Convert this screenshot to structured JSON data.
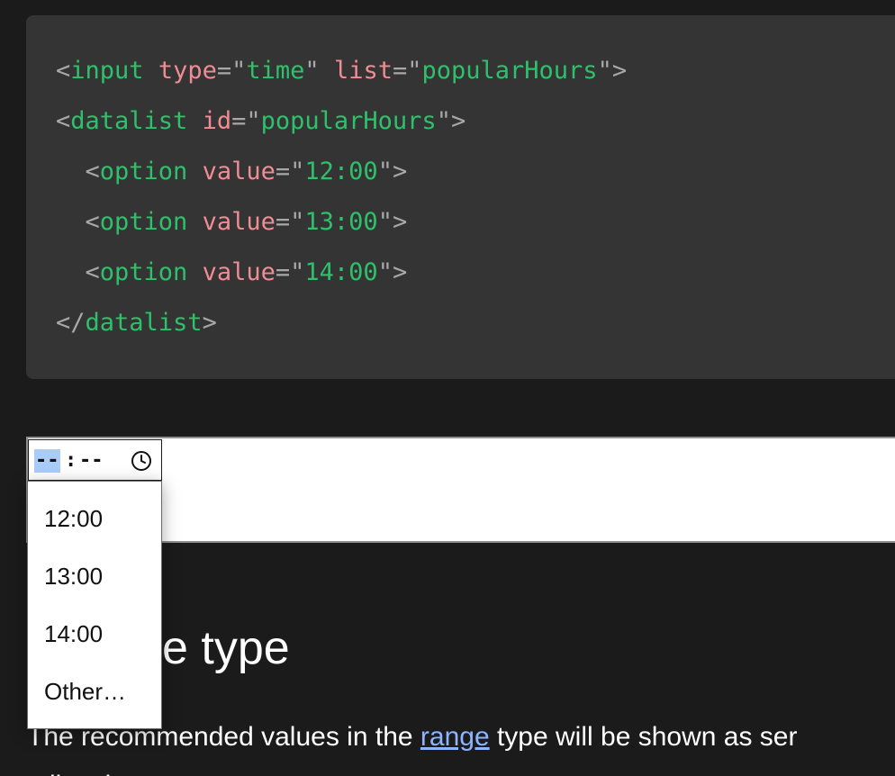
{
  "code": {
    "lines": [
      {
        "indent": "",
        "tag_open": "<",
        "tag": "input",
        "attrs": [
          {
            "name": "type",
            "value": "\"time\""
          },
          {
            "name": "list",
            "value": "\"popularHours\""
          }
        ],
        "tag_close": ">"
      },
      {
        "indent": "",
        "tag_open": "<",
        "tag": "datalist",
        "attrs": [
          {
            "name": "id",
            "value": "\"popularHours\""
          }
        ],
        "tag_close": ">"
      },
      {
        "indent": "  ",
        "tag_open": "<",
        "tag": "option",
        "attrs": [
          {
            "name": "value",
            "value": "\"12:00\""
          }
        ],
        "tag_close": ">"
      },
      {
        "indent": "  ",
        "tag_open": "<",
        "tag": "option",
        "attrs": [
          {
            "name": "value",
            "value": "\"13:00\""
          }
        ],
        "tag_close": ">"
      },
      {
        "indent": "  ",
        "tag_open": "<",
        "tag": "option",
        "attrs": [
          {
            "name": "value",
            "value": "\"14:00\""
          }
        ],
        "tag_close": ">"
      },
      {
        "indent": "",
        "tag_open": "</",
        "tag": "datalist",
        "attrs": [],
        "tag_close": ">"
      }
    ]
  },
  "time_input": {
    "hours": "--",
    "colon": ":",
    "minutes": "--",
    "icon": "clock-icon"
  },
  "dropdown": {
    "options": [
      "12:00",
      "13:00",
      "14:00",
      "Other…"
    ]
  },
  "section": {
    "heading_visible": "e type",
    "paragraph_before": "The recommended values in the ",
    "paragraph_link": "range",
    "paragraph_after": " type will be shown as ser",
    "paragraph_line2": "mil n sl t"
  },
  "colors": {
    "page_bg": "#1b1b1b",
    "code_bg": "#343434",
    "tag": "#2ec16b",
    "attr": "#f08c94",
    "punctuation": "#a8a8a8",
    "link": "#8cb4ff",
    "selection": "#a9cdf8"
  }
}
